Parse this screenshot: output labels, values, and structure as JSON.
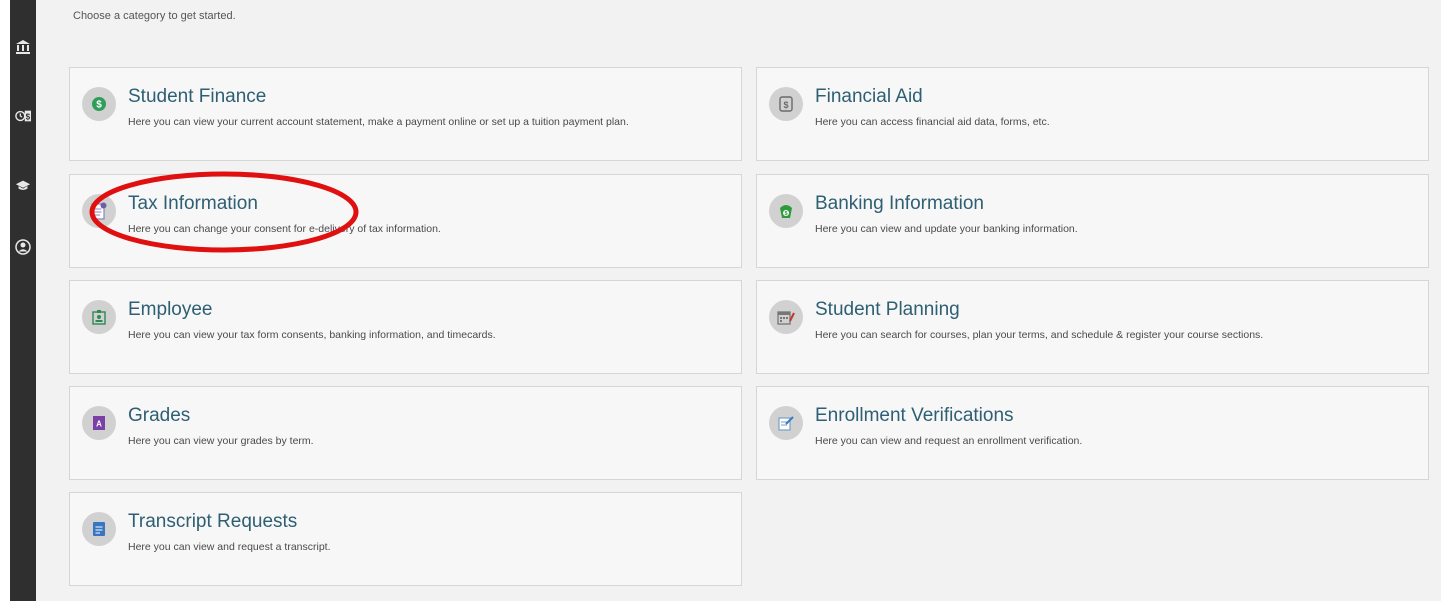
{
  "intro_text": "Choose a category to get started.",
  "cards": [
    {
      "title": "Student Finance",
      "description": "Here you can view your current account statement, make a payment online or set up a tuition payment plan.",
      "icon": "money-icon",
      "icon_color": "#2e9e58"
    },
    {
      "title": "Financial Aid",
      "description": "Here you can access financial aid data, forms, etc.",
      "icon": "dollar-card-icon",
      "icon_color": "#6a6a6a"
    },
    {
      "title": "Tax Information",
      "description": "Here you can change your consent for e-delivery of tax information.",
      "icon": "tax-document-icon",
      "icon_color": "#6d5fa6"
    },
    {
      "title": "Banking Information",
      "description": "Here you can view and update your banking information.",
      "icon": "bank-money-icon",
      "icon_color": "#2f9a3b"
    },
    {
      "title": "Employee",
      "description": "Here you can view your tax form consents, banking information, and timecards.",
      "icon": "badge-icon",
      "icon_color": "#2e8a55"
    },
    {
      "title": "Student Planning",
      "description": "Here you can search for courses, plan your terms, and schedule & register your course sections.",
      "icon": "calendar-icon",
      "icon_color": "#777777"
    },
    {
      "title": "Grades",
      "description": "Here you can view your grades by term.",
      "icon": "grade-icon",
      "icon_color": "#7b3fa8"
    },
    {
      "title": "Enrollment Verifications",
      "description": "Here you can view and request an enrollment verification.",
      "icon": "verify-icon",
      "icon_color": "#3a7ac0"
    },
    {
      "title": "Transcript Requests",
      "description": "Here you can view and request a transcript.",
      "icon": "transcript-icon",
      "icon_color": "#3876c2"
    }
  ],
  "sidebar_icons": [
    "bank-icon",
    "finance-icon",
    "graduation-cap-icon",
    "user-icon"
  ],
  "annotation_color": "#e01010",
  "accent_color": "#2e5f73"
}
